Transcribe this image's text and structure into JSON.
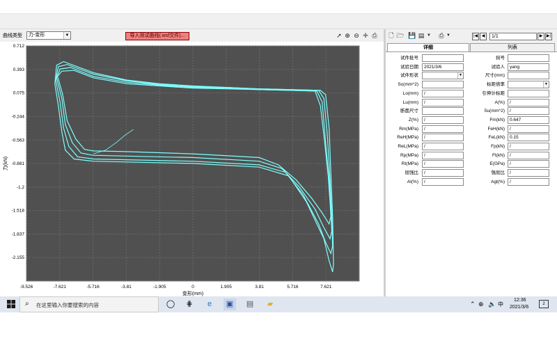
{
  "toolbar": {
    "curve_type_label": "曲线类型",
    "curve_type_value": "力-变形",
    "import_button": "导入测试曲线(.wsf文件)..."
  },
  "nav": {
    "record": "1/1"
  },
  "tabs": {
    "detail": "详细",
    "list": "列表"
  },
  "fields_left": [
    {
      "label": "试件批号",
      "value": ""
    },
    {
      "label": "试验日期",
      "value": "2021/3/6"
    },
    {
      "label": "试件形状",
      "value": "",
      "dropdown": true
    },
    {
      "label": "So(mm^2)",
      "value": ""
    },
    {
      "label": "Lo(mm)",
      "value": "/"
    },
    {
      "label": "Lu(mm)",
      "value": "/"
    },
    {
      "label": "断面尺寸",
      "value": ""
    },
    {
      "label": "Z(%)",
      "value": "/"
    },
    {
      "label": "Rm(MPa)",
      "value": "/"
    },
    {
      "label": "ReH(MPa)",
      "value": "/"
    },
    {
      "label": "ReL(MPa)",
      "value": "/"
    },
    {
      "label": "Rp(MPa)",
      "value": "/"
    },
    {
      "label": "Rt(MPa)",
      "value": "/"
    },
    {
      "label": "屈强比",
      "value": "/"
    },
    {
      "label": "At(%)",
      "value": "/"
    }
  ],
  "fields_right": [
    {
      "label": "拐号",
      "value": ""
    },
    {
      "label": "试验人",
      "value": "yang"
    },
    {
      "label": "尺寸(mm)",
      "value": ""
    },
    {
      "label": "标距倍率",
      "value": "",
      "dropdown": true
    },
    {
      "label": "引伸计标距",
      "value": ""
    },
    {
      "label": "A(%)",
      "value": "/"
    },
    {
      "label": "Su(mm^2)",
      "value": "/"
    },
    {
      "label": "Fm(kN)",
      "value": "0.647"
    },
    {
      "label": "FeH(kN)",
      "value": "/"
    },
    {
      "label": "FeL(kN)",
      "value": "0.15"
    },
    {
      "label": "Fp(kN)",
      "value": "/"
    },
    {
      "label": "Ft(kN)",
      "value": "/"
    },
    {
      "label": "E(GPa)",
      "value": "/"
    },
    {
      "label": "强屈比",
      "value": "/"
    },
    {
      "label": "Agt(%)",
      "value": "/"
    }
  ],
  "chart_data": {
    "type": "line",
    "xlabel": "变形(mm)",
    "ylabel": "力(kN)",
    "xticks": [
      "-9.526",
      "-7.621",
      "-5.716",
      "-3.81",
      "-1.905",
      "0",
      "1.905",
      "3.81",
      "5.716",
      "7.621"
    ],
    "yticks": [
      "0.712",
      "0.393",
      "0.075",
      "-0.244",
      "-0.563",
      "-0.881",
      "-1.2",
      "-1.518",
      "-1.837",
      "-2.155"
    ],
    "xlim": [
      -9.526,
      9.526
    ],
    "ylim": [
      -2.474,
      0.712
    ],
    "grid": true,
    "background": "#505050",
    "line_color": "#7fffff",
    "series": [
      {
        "x": [
          -7.9,
          -7.8,
          -7.4,
          -5.7,
          -3.8,
          -1.9,
          0,
          1.9,
          3.8,
          5.7,
          7.3,
          7.6,
          7.8,
          7.9,
          8.0,
          8.05,
          8.0,
          7.8,
          7.5,
          6.5,
          5.5,
          3.8,
          0,
          -3.8,
          -5.7,
          -6.8,
          -7.3,
          -7.5,
          -7.7,
          -7.9
        ],
        "y": [
          0.2,
          0.45,
          0.5,
          0.35,
          0.25,
          0.2,
          0.17,
          0.15,
          0.13,
          0.12,
          0.11,
          0.05,
          -0.4,
          -1.0,
          -1.6,
          -2.25,
          -2.35,
          -2.2,
          -1.9,
          -1.4,
          -1.05,
          -0.93,
          -0.88,
          -0.86,
          -0.85,
          -0.82,
          -0.7,
          -0.45,
          -0.1,
          0.2
        ]
      },
      {
        "x": [
          -7.85,
          -7.7,
          -7.2,
          -5.7,
          -3.8,
          -1.9,
          0,
          1.9,
          3.8,
          5.7,
          7.2,
          7.5,
          7.7,
          7.85,
          7.95,
          8.0,
          7.9,
          7.6,
          7.2,
          6.3,
          5.3,
          3.8,
          0,
          -3.8,
          -5.7,
          -6.6,
          -7.1,
          -7.4,
          -7.6,
          -7.85
        ],
        "y": [
          0.25,
          0.43,
          0.46,
          0.33,
          0.24,
          0.19,
          0.16,
          0.15,
          0.13,
          0.12,
          0.11,
          0.0,
          -0.5,
          -1.1,
          -1.6,
          -2.0,
          -2.1,
          -1.95,
          -1.7,
          -1.3,
          -1.0,
          -0.9,
          -0.85,
          -0.83,
          -0.82,
          -0.79,
          -0.65,
          -0.4,
          -0.05,
          0.25
        ]
      },
      {
        "x": [
          -7.8,
          -7.6,
          -7.0,
          -5.7,
          -3.8,
          -1.9,
          0,
          1.9,
          3.8,
          5.7,
          7.1,
          7.4,
          7.6,
          7.8,
          7.9,
          7.95,
          7.85,
          7.5,
          7.0,
          6.1,
          5.1,
          3.8,
          0,
          -3.8,
          -5.7,
          -6.4,
          -6.9,
          -7.3,
          -7.5,
          -7.8
        ],
        "y": [
          0.28,
          0.4,
          0.42,
          0.3,
          0.22,
          0.18,
          0.15,
          0.14,
          0.12,
          0.11,
          0.1,
          -0.05,
          -0.6,
          -1.1,
          -1.5,
          -1.8,
          -1.9,
          -1.75,
          -1.5,
          -1.2,
          -0.95,
          -0.85,
          -0.8,
          -0.78,
          -0.77,
          -0.74,
          -0.6,
          -0.35,
          0.0,
          0.28
        ]
      },
      {
        "x": [
          -7.75,
          -7.5,
          -6.8,
          -5.7,
          -3.8,
          -1.9,
          0,
          1.9,
          3.8,
          5.7,
          7.0,
          7.3,
          7.55,
          7.75,
          7.85,
          7.9,
          7.8,
          7.4,
          6.8,
          5.9,
          4.9,
          3.8,
          0,
          -3.8,
          -5.7,
          -6.2,
          -6.7,
          -7.2,
          -7.45,
          -7.75
        ],
        "y": [
          0.3,
          0.37,
          0.38,
          0.28,
          0.2,
          0.17,
          0.14,
          0.13,
          0.12,
          0.11,
          0.1,
          -0.1,
          -0.6,
          -1.05,
          -1.4,
          -1.6,
          -1.7,
          -1.55,
          -1.35,
          -1.1,
          -0.9,
          -0.8,
          -0.75,
          -0.72,
          -0.71,
          -0.69,
          -0.55,
          -0.3,
          0.05,
          0.3
        ]
      },
      {
        "x": [
          -5.7,
          -5.0,
          -4.4,
          -3.9,
          -3.4
        ],
        "y": [
          -0.75,
          -0.7,
          -0.6,
          -0.5,
          -0.42
        ]
      }
    ]
  },
  "taskbar": {
    "search_placeholder": "在这里输入你要搜索的内容",
    "ime": "中",
    "time": "12:36",
    "date": "2021/3/6",
    "notif_count": "2"
  }
}
